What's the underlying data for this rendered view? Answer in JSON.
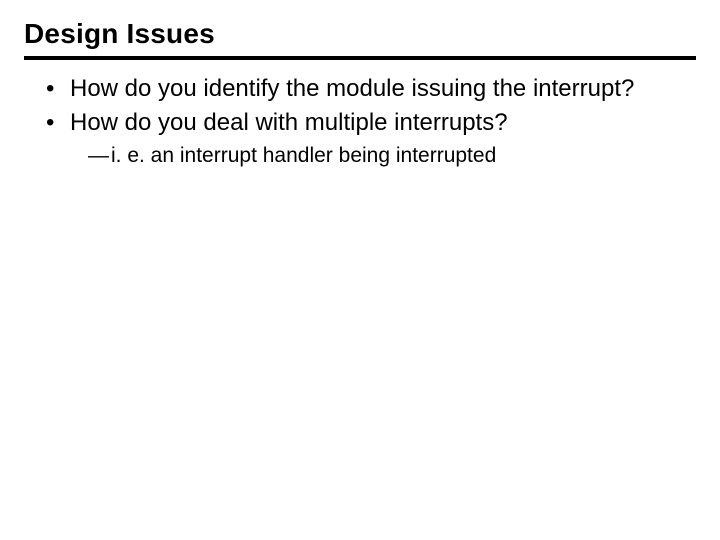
{
  "title": "Design Issues",
  "bullets": [
    {
      "text": "How do you identify the module issuing the interrupt?"
    },
    {
      "text": "How do you deal with multiple interrupts?"
    }
  ],
  "sub": {
    "dash": "—",
    "text": "i. e. an interrupt handler being interrupted"
  }
}
